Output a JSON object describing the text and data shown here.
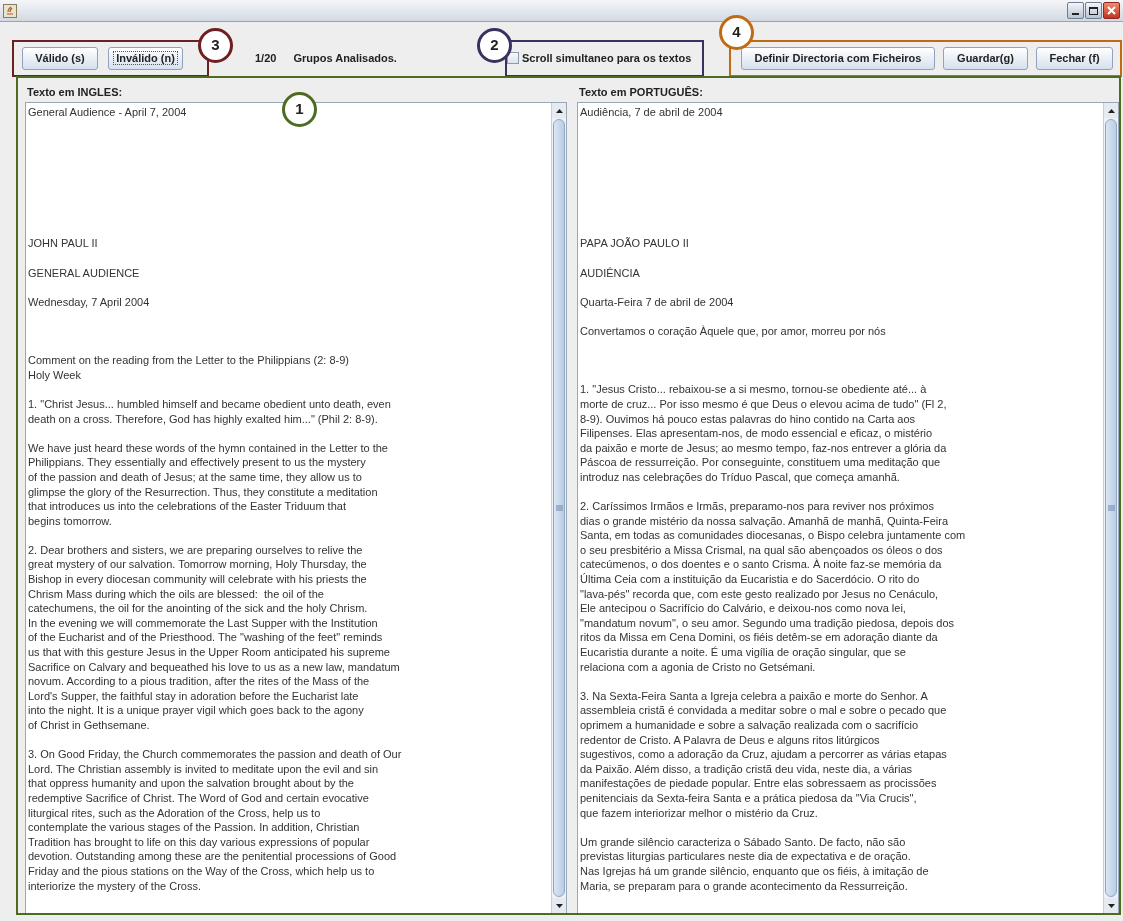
{
  "toolbar": {
    "buttons": [
      {
        "label": "Válido (s)",
        "focused": false
      },
      {
        "label": "Inválido (n)",
        "focused": true
      }
    ],
    "counter": "1/20",
    "counter_label": "Grupos Analisados.",
    "scroll_checkbox": {
      "label": "Scroll simultaneo para os textos",
      "checked": false
    },
    "right_buttons": [
      {
        "label": "Definir Directoria com Ficheiros"
      },
      {
        "label": "Guardar(g)"
      },
      {
        "label": "Fechar (f)"
      }
    ]
  },
  "panels": [
    {
      "title": "Texto em INGLES:",
      "paragraphs": [
        [
          "General Audience - April 7, 2004"
        ],
        [
          "JOHN PAUL II"
        ],
        [
          "GENERAL AUDIENCE"
        ],
        [
          "Wednesday, 7 April 2004"
        ],
        [
          "Comment on the reading from the Letter to the Philippians (2: 8-9)",
          "Holy Week"
        ],
        [
          "1. \"Christ Jesus... humbled himself and became obedient unto death, even",
          "death on a cross. Therefore, God has highly exalted him...\" (Phil 2: 8-9)."
        ],
        [
          "We have just heard these words of the hymn contained in the Letter to the",
          "Philippians. They essentially and effectively present to us the mystery",
          "of the passion and death of Jesus; at the same time, they allow us to",
          "glimpse the glory of the Resurrection. Thus, they constitute a meditation",
          "that introduces us into the celebrations of the Easter Triduum that",
          "begins tomorrow."
        ],
        [
          "2. Dear brothers and sisters, we are preparing ourselves to relive the",
          "great mystery of our salvation. Tomorrow morning, Holy Thursday, the",
          "Bishop in every diocesan community will celebrate with his priests the",
          "Chrism Mass during which the oils are blessed:  the oil of the",
          "catechumens, the oil for the anointing of the sick and the holy Chrism.",
          "In the evening we will commemorate the Last Supper with the Institution",
          "of the Eucharist and of the Priesthood. The \"washing of the feet\" reminds",
          "us that with this gesture Jesus in the Upper Room anticipated his supreme",
          "Sacrifice on Calvary and bequeathed his love to us as a new law, mandatum",
          "novum. According to a pious tradition, after the rites of the Mass of the",
          "Lord's Supper, the faithful stay in adoration before the Eucharist late",
          "into the night. It is a unique prayer vigil which goes back to the agony",
          "of Christ in Gethsemane."
        ],
        [
          "3. On Good Friday, the Church commemorates the passion and death of Our",
          "Lord. The Christian assembly is invited to meditate upon the evil and sin",
          "that oppress humanity and upon the salvation brought about by the",
          "redemptive Sacrifice of Christ. The Word of God and certain evocative",
          "liturgical rites, such as the Adoration of the Cross, help us to",
          "contemplate the various stages of the Passion. In addition, Christian",
          "Tradition has brought to life on this day various expressions of popular",
          "devotion. Outstanding among these are the penitential processions of Good",
          "Friday and the pious stations on the Way of the Cross, which help us to",
          "interiorize the mystery of the Cross."
        ]
      ]
    },
    {
      "title": "Texto em PORTUGUÊS:",
      "paragraphs": [
        [
          "Audiência, 7 de abril de 2004"
        ],
        [
          "PAPA JOÃO PAULO II"
        ],
        [
          "AUDIÊNCIA"
        ],
        [
          "Quarta-Feira 7 de abril de 2004"
        ],
        [
          "Convertamos o coração Àquele que, por amor, morreu por nós"
        ],
        [
          "1. \"Jesus Cristo... rebaixou-se a si mesmo, tornou-se obediente até... à",
          "morte de cruz... Por isso mesmo é que Deus o elevou acima de tudo\" (Fl 2,",
          "8-9). Ouvimos há pouco estas palavras do hino contido na Carta aos",
          "Filipenses. Elas apresentam-nos, de modo essencial e eficaz, o mistério",
          "da paixão e morte de Jesus; ao mesmo tempo, faz-nos entrever a glória da",
          "Páscoa de ressurreição. Por conseguinte, constituem uma meditação que",
          "introduz nas celebrações do Tríduo Pascal, que começa amanhã."
        ],
        [
          "2. Caríssimos Irmãos e Irmãs, preparamo-nos para reviver nos próximos",
          "dias o grande mistério da nossa salvação. Amanhã de manhã, Quinta-Feira",
          "Santa, em todas as comunidades diocesanas, o Bispo celebra juntamente com",
          "o seu presbitério a Missa Crismal, na qual são abençoados os óleos o dos",
          "catecúmenos, o dos doentes e o santo Crisma. À noite faz-se memória da",
          "Última Ceia com a instituição da Eucaristia e do Sacerdócio. O rito do",
          "\"lava-pés\" recorda que, com este gesto realizado por Jesus no Cenáculo,",
          "Ele antecipou o Sacrifício do Calvário, e deixou-nos como nova lei,",
          "\"mandatum novum\", o seu amor. Segundo uma tradição piedosa, depois dos",
          "ritos da Missa em Cena Domini, os fiéis detêm-se em adoração diante da",
          "Eucaristia durante a noite. É uma vigília de oração singular, que se",
          "relaciona com a agonia de Cristo no Getsémani."
        ],
        [
          "3. Na Sexta-Feira Santa a Igreja celebra a paixão e morte do Senhor. A",
          "assembleia cristã é convidada a meditar sobre o mal e sobre o pecado que",
          "oprimem a humanidade e sobre a salvação realizada com o sacrifício",
          "redentor de Cristo. A Palavra de Deus e alguns ritos litúrgicos",
          "sugestivos, como a adoração da Cruz, ajudam a percorrer as várias etapas",
          "da Paixão. Além disso, a tradição cristã deu vida, neste dia, a várias",
          "manifestações de piedade popular. Entre elas sobressaem as procissões",
          "penitenciais da Sexta-feira Santa e a prática piedosa da \"Via Crucis\",",
          "que fazem interiorizar melhor o mistério da Cruz."
        ],
        [
          "Um grande silêncio caracteriza o Sábado Santo. De facto, não são",
          "previstas liturgias particulares neste dia de expectativa e de oração.",
          "Nas Igrejas há um grande silêncio, enquanto que os fiéis, à imitação de",
          "Maria, se preparam para o grande acontecimento da Ressurreição."
        ]
      ]
    }
  ],
  "annotations": [
    {
      "label": "3",
      "color": "#6e1f1f"
    },
    {
      "label": "2",
      "color": "#3b3160"
    },
    {
      "label": "4",
      "color": "#c06a14"
    },
    {
      "label": "1",
      "color": "#4f6b22"
    }
  ]
}
